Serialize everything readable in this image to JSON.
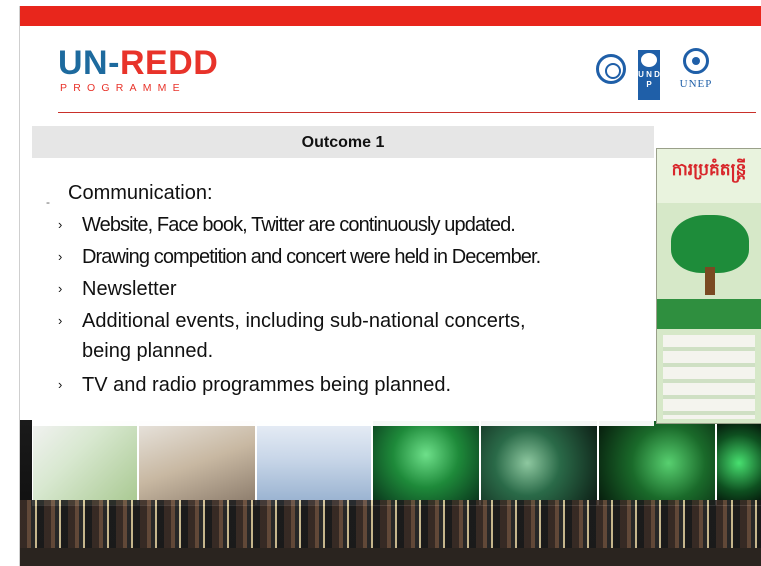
{
  "header": {
    "logo_un": "UN-",
    "logo_redd": "REDD",
    "logo_sub": "PROGRAMME",
    "undp_letters": "U N D P",
    "unep_text": "UNEP"
  },
  "poster": {
    "title": "ការប្រគំតន្ត្រី"
  },
  "slide": {
    "title": "Outcome 1",
    "section_marker": "-",
    "heading": "Communication:",
    "bullet_marker": "›",
    "bullets": [
      "Website, Face book, Twitter are continuously  updated.",
      "Drawing competition and concert  were held in December.",
      "Newsletter",
      "Additional events, including sub-national concerts,",
      "TV and radio programmes being planned."
    ],
    "bullet_4_continuation": "being planned."
  },
  "colors": {
    "top_bar": "#e8261c",
    "logo_blue": "#1d6a9e",
    "logo_red": "#e8332a",
    "rule": "#c9302a"
  },
  "icons": [
    "fao-logo",
    "undp-logo",
    "unep-logo"
  ]
}
